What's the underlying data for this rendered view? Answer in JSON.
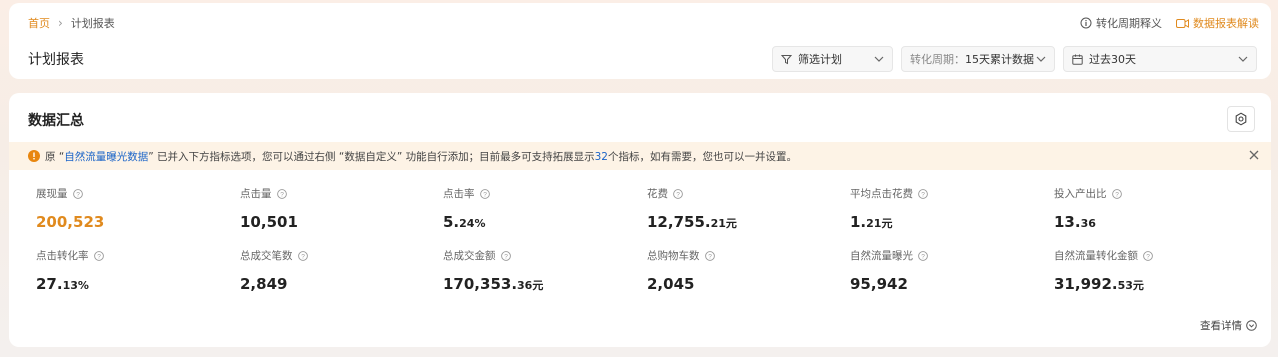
{
  "breadcrumb": {
    "home": "首页",
    "current": "计划报表"
  },
  "page_title": "计划报表",
  "links": {
    "help": "转化周期释义",
    "guide": "数据报表解读"
  },
  "filters": {
    "plan": "筛选计划",
    "cycle_label": "转化周期：",
    "cycle_value": "15天累计数据",
    "date": "过去30天"
  },
  "summary": {
    "title": "数据汇总",
    "notice": {
      "prefix": "原 “",
      "highlight": "自然流量曝光数据",
      "middle": "” 已并入下方指标选项，您可以通过右侧 “数据自定义” 功能自行添加；目前最多可支持拓展显示",
      "count": "32",
      "suffix": "个指标，如有需要，您也可以一并设置。"
    },
    "metrics": [
      {
        "label": "展现量",
        "value": "200,523",
        "small": ""
      },
      {
        "label": "点击量",
        "value": "10,501",
        "small": ""
      },
      {
        "label": "点击率",
        "value": "5.",
        "small": "24%"
      },
      {
        "label": "花费",
        "value": "12,755.",
        "small": "21元"
      },
      {
        "label": "平均点击花费",
        "value": "1.",
        "small": "21元"
      },
      {
        "label": "投入产出比",
        "value": "13.",
        "small": "36"
      },
      {
        "label": "点击转化率",
        "value": "27.",
        "small": "13%"
      },
      {
        "label": "总成交笔数",
        "value": "2,849",
        "small": ""
      },
      {
        "label": "总成交金额",
        "value": "170,353.",
        "small": "36元"
      },
      {
        "label": "总购物车数",
        "value": "2,045",
        "small": ""
      },
      {
        "label": "自然流量曝光",
        "value": "95,942",
        "small": ""
      },
      {
        "label": "自然流量转化金额",
        "value": "31,992.",
        "small": "53元"
      }
    ],
    "detail_link": "查看详情"
  },
  "colors": {
    "accent": "#e08a1e",
    "link": "#1a64c8"
  }
}
